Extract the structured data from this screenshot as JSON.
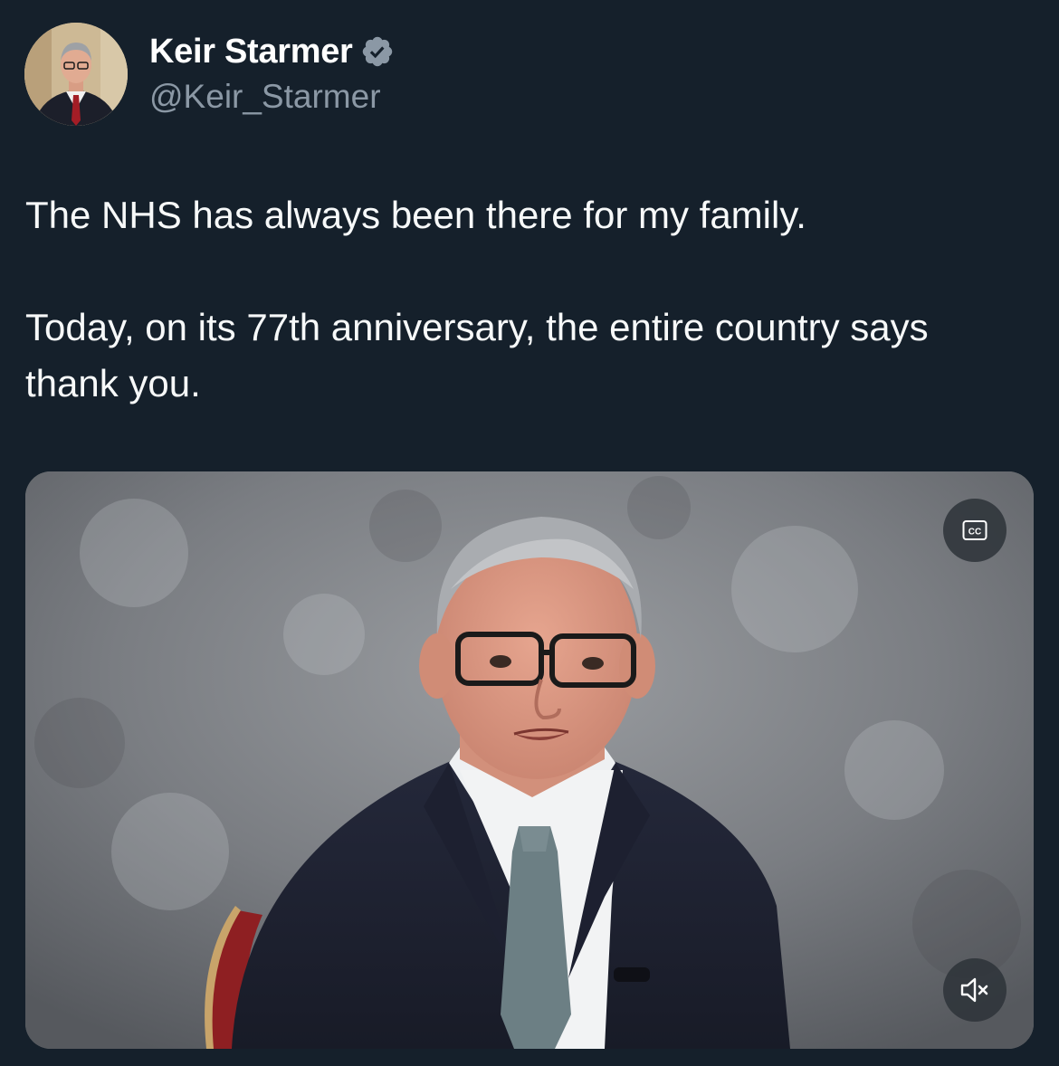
{
  "author": {
    "display_name": "Keir Starmer",
    "handle": "@Keir_Starmer",
    "verified_icon": "verified-badge-icon",
    "verified_color": "#8b98a5"
  },
  "tweet": {
    "paragraphs": [
      "The NHS has always been there for my family.",
      "Today, on its 77th anniversary, the entire country says thank you."
    ]
  },
  "media": {
    "type": "video",
    "captions_icon": "cc-icon",
    "mute_icon": "speaker-muted-icon"
  },
  "colors": {
    "background": "#15202b",
    "text": "#f7f9f9",
    "secondary_text": "#8b98a5"
  }
}
